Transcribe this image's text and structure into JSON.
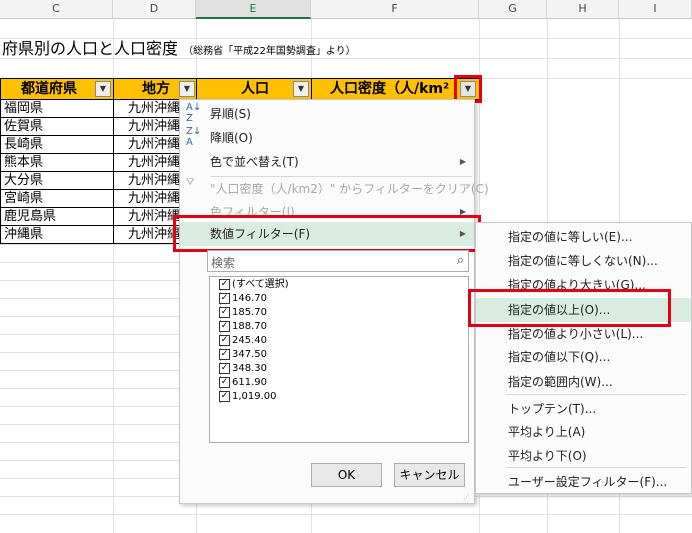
{
  "columns": [
    "C",
    "D",
    "E",
    "F",
    "G",
    "H",
    "I"
  ],
  "title": {
    "main": "府県別の人口と人口密度",
    "source": "（総務省「平成22年国勢調査」より）"
  },
  "table": {
    "headers": [
      "都道府県",
      "地方",
      "人口",
      "人口密度（人/km²"
    ],
    "prefectures": [
      "福岡県",
      "佐賀県",
      "長崎県",
      "熊本県",
      "大分県",
      "宮崎県",
      "鹿児島県",
      "沖縄県"
    ],
    "region": "九州沖縄"
  },
  "menu": {
    "sort_asc": "昇順(S)",
    "sort_desc": "降順(O)",
    "sort_color": "色で並べ替え(T)",
    "clear_filter": "\"人口密度（人/km2）\" からフィルターをクリア(C)",
    "color_filter": "色フィルター(I)",
    "number_filter": "数値フィルター(F)",
    "search_placeholder": "検索",
    "list": [
      "(すべて選択)",
      "146.70",
      "185.70",
      "188.70",
      "245.40",
      "347.50",
      "348.30",
      "611.90",
      "1,019.00"
    ],
    "ok": "OK",
    "cancel": "キャンセル"
  },
  "submenu": {
    "items": [
      "指定の値に等しい(E)...",
      "指定の値に等しくない(N)...",
      "指定の値より大きい(G)...",
      "指定の値以上(O)...",
      "指定の値より小さい(L)...",
      "指定の値以下(Q)...",
      "指定の範囲内(W)...",
      "トップテン(T)...",
      "平均より上(A)",
      "平均より下(O)",
      "ユーザー設定フィルター(F)..."
    ]
  },
  "colors": {
    "header_fill": "#ffc000",
    "highlight": "#e60012",
    "hover": "#d9ecdf"
  }
}
